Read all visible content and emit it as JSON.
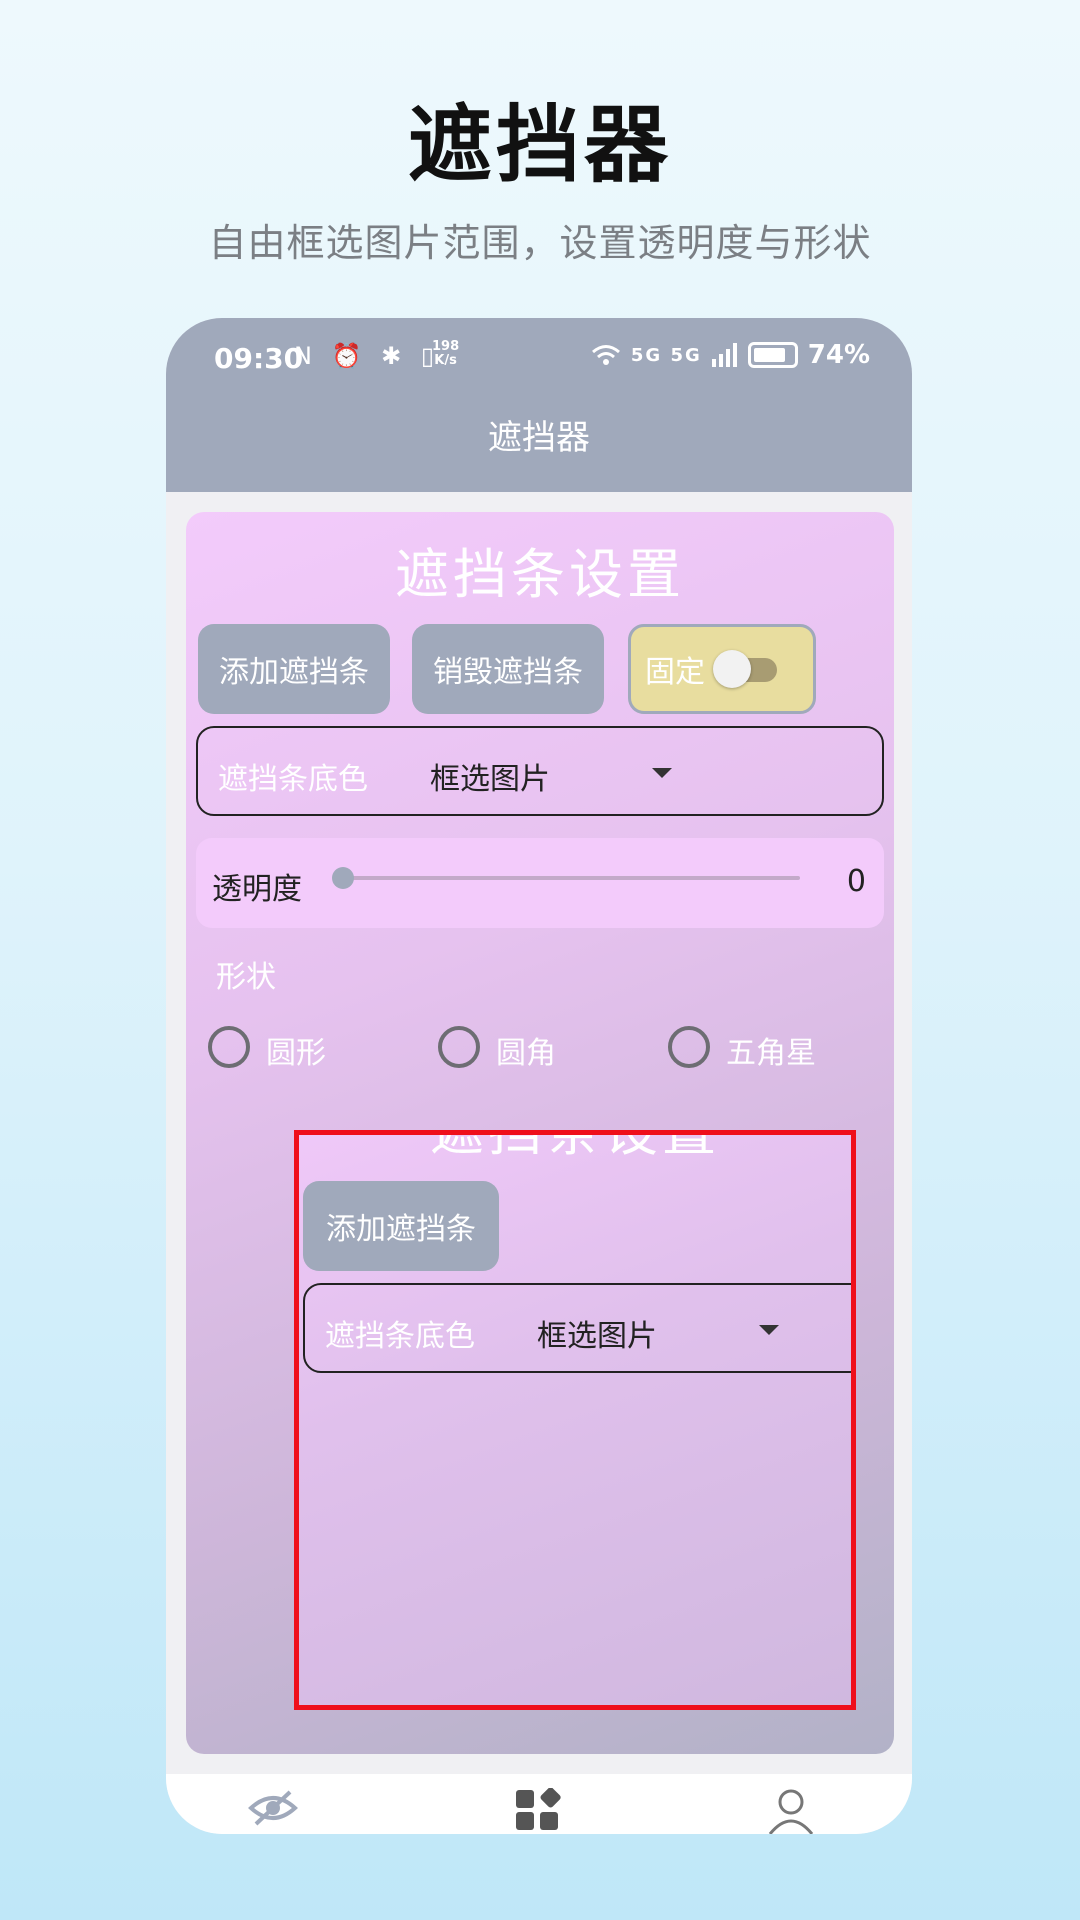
{
  "promo": {
    "title": "遮挡器",
    "subtitle": "自由框选图片范围，设置透明度与形状"
  },
  "status_bar": {
    "time": "09:30",
    "left_icons": "N ⏰ ✱ ▯",
    "speed_value": "198",
    "speed_unit": "K/s",
    "network": "5G 5G",
    "battery_percent": "74%"
  },
  "app_bar": {
    "title": "遮挡器"
  },
  "panel": {
    "title": "遮挡条设置",
    "add_button": "添加遮挡条",
    "destroy_button": "销毁遮挡条",
    "fix_toggle": {
      "label": "固定",
      "on": false
    },
    "color_select": {
      "label": "遮挡条底色",
      "value": "框选图片"
    },
    "opacity": {
      "label": "透明度",
      "value": "0"
    },
    "shape": {
      "label": "形状",
      "options": [
        "圆形",
        "圆角",
        "五角星"
      ]
    }
  },
  "overlay_preview": {
    "title": "遮挡条设置",
    "add_button": "添加遮挡条",
    "color_select": {
      "label": "遮挡条底色",
      "value": "框选图片"
    },
    "border_color": "#ef0f1b"
  },
  "bottom_nav": {
    "items": [
      "eye-slash-icon",
      "apps-icon",
      "user-icon"
    ]
  },
  "colors": {
    "accent": "#a0a9bb",
    "toggle_bg": "#e8dd9f",
    "panel_pink": "#f3cbfb"
  }
}
